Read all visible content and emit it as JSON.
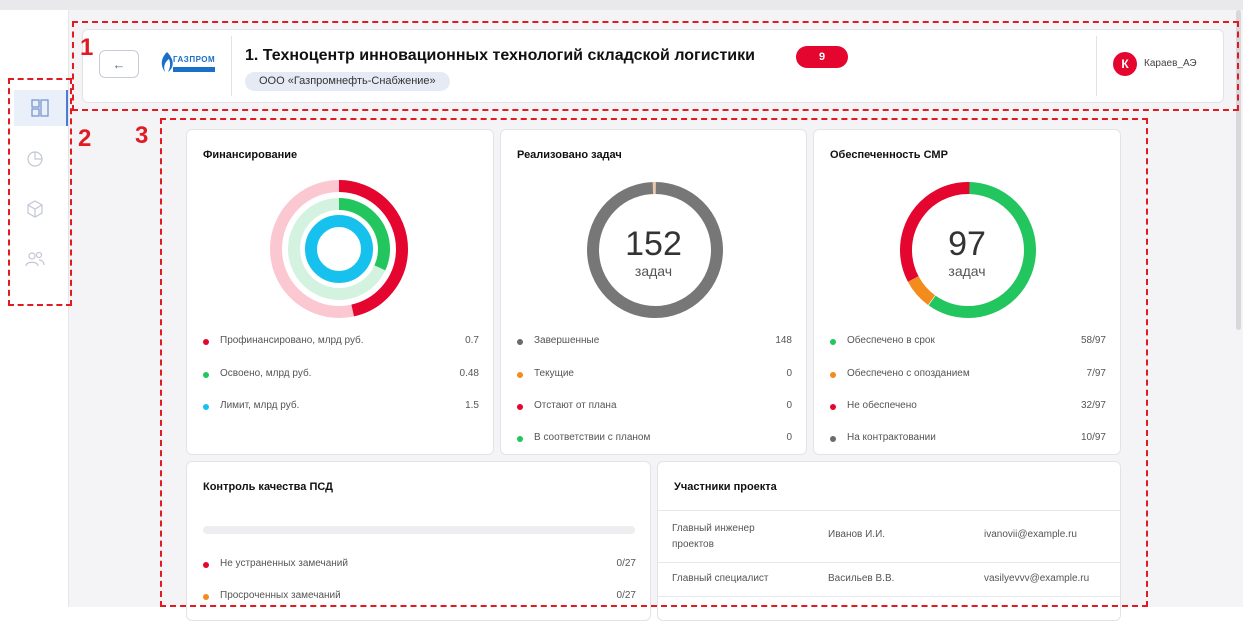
{
  "annotations": {
    "n1": "1",
    "n2": "2",
    "n3": "3"
  },
  "sidebar": {
    "items": [
      {
        "icon": "dashboard-icon",
        "active": true
      },
      {
        "icon": "pie-chart-icon",
        "active": false
      },
      {
        "icon": "cube-icon",
        "active": false
      },
      {
        "icon": "users-icon",
        "active": false
      }
    ]
  },
  "header": {
    "back_label": "←",
    "logo_text": "ГАЗПРОМ",
    "title": "1. Техноцентр инновационных технологий складской логистики",
    "badge_count": "9",
    "company": "ООО «Газпромнефть-Снабжение»",
    "avatar_initial": "К",
    "username": "Караев_АЭ"
  },
  "cards": {
    "financing": {
      "title": "Финансирование",
      "rows": [
        {
          "label": "Профинансировано, млрд руб.",
          "value": "0.7",
          "color": "#e4062e"
        },
        {
          "label": "Освоено, млрд руб.",
          "value": "0.48",
          "color": "#22c55e"
        },
        {
          "label": "Лимит, млрд руб.",
          "value": "1.5",
          "color": "#16c1ee"
        }
      ]
    },
    "tasks": {
      "title": "Реализовано задач",
      "center_value": "152",
      "center_unit": "задач",
      "rows": [
        {
          "label": "Завершенные",
          "value": "148",
          "color": "#6b6b6b"
        },
        {
          "label": "Текущие",
          "value": "0",
          "color": "#f28c1c"
        },
        {
          "label": "Отстают от плана",
          "value": "0",
          "color": "#e4062e"
        },
        {
          "label": "В соответствии с планом",
          "value": "0",
          "color": "#22c55e"
        }
      ]
    },
    "supply": {
      "title": "Обеспеченность СМР",
      "center_value": "97",
      "center_unit": "задач",
      "rows": [
        {
          "label": "Обеспечено в срок",
          "value": "58/97",
          "color": "#22c55e"
        },
        {
          "label": "Обеспечено с опозданием",
          "value": "7/97",
          "color": "#f28c1c"
        },
        {
          "label": "Не обеспечено",
          "value": "32/97",
          "color": "#e4062e"
        },
        {
          "label": "На контрактовании",
          "value": "10/97",
          "color": "#6b6b6b"
        }
      ]
    },
    "quality": {
      "title": "Контроль качества ПСД",
      "rows": [
        {
          "label": "Не устраненных замечаний",
          "value": "0/27",
          "color": "#e4062e"
        },
        {
          "label": "Просроченных замечаний",
          "value": "0/27",
          "color": "#f28c1c"
        }
      ]
    },
    "participants": {
      "title": "Участники проекта",
      "rows": [
        {
          "role": "Главный инженер проектов",
          "name": "Иванов И.И.",
          "email": "ivanovii@example.ru"
        },
        {
          "role": "Главный специалист",
          "name": "Васильев В.В.",
          "email": "vasilyevvv@example.ru"
        }
      ]
    }
  }
}
